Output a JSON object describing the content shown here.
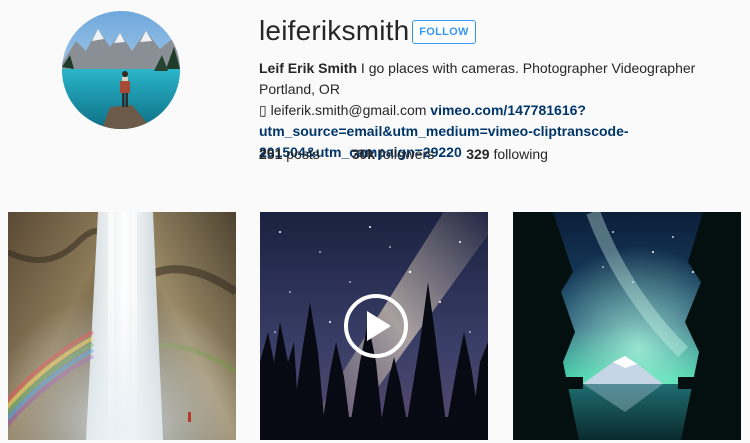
{
  "profile": {
    "username": "leiferiksmith",
    "follow_label": "FOLLOW",
    "full_name": "Leif Erik Smith",
    "bio_text": " I go places with cameras. Photographer Videographer Portland, OR ",
    "mail_glyph": "▯",
    "email": " leiferik.smith@gmail.com ",
    "link_line1": "vimeo.com/147781616?",
    "link_line2": "utm_source=email&utm_medium=vimeo-cliptranscode-",
    "link_line3": "201504&utm_campaign=29220"
  },
  "stats": {
    "posts_count": "251",
    "posts_label": "posts",
    "followers_count": "30k",
    "followers_label": "followers",
    "following_count": "329",
    "following_label": "following"
  },
  "posts": [
    {
      "kind": "photo",
      "subject": "waterfall-with-rainbow"
    },
    {
      "kind": "video",
      "subject": "milky-way-over-forest",
      "icon": "play-icon"
    },
    {
      "kind": "photo",
      "subject": "aurora-over-mountain-lake"
    }
  ],
  "colors": {
    "accent": "#3897f0",
    "link": "#003569",
    "text": "#262626",
    "background": "#fafafa"
  }
}
